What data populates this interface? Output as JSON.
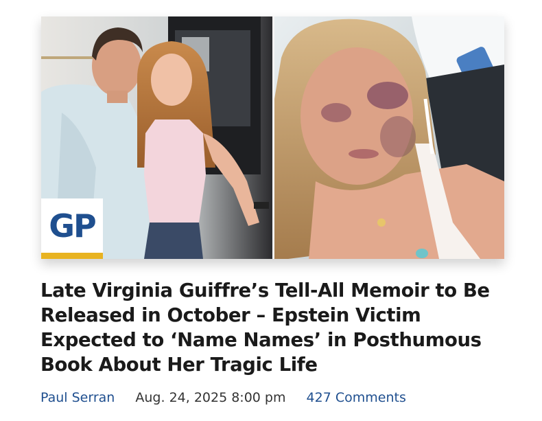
{
  "article": {
    "headline": "Late Virginia Guiffre’s Tell-All Memoir to Be Released in October – Epstein Victim Expected to ‘Name Names’ in Posthumous Book About Her Tragic Life",
    "author": "Paul Serran",
    "date": "Aug. 24, 2025 8:00 pm",
    "comments": "427 Comments"
  },
  "logo": {
    "text": "GP"
  },
  "colors": {
    "brand_blue": "#1f4f8f",
    "logo_gold": "#e8b321",
    "headline": "#1a1a1a",
    "date": "#333333"
  },
  "icons": [
    "gp-logo"
  ]
}
